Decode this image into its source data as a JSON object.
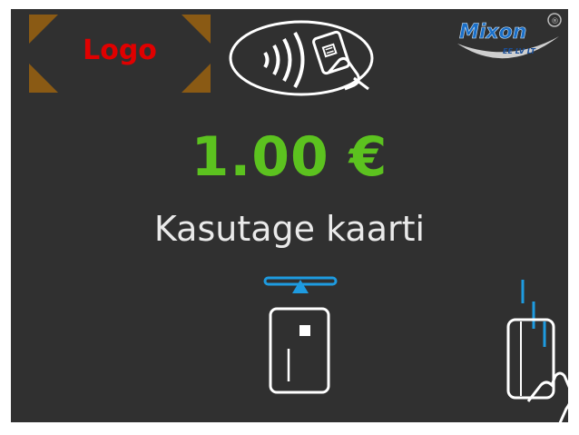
{
  "header": {
    "logo_text": "Logo",
    "brand_name": "Mixon",
    "brand_tagline": "EE LV LT",
    "brand_mark": "®"
  },
  "payment": {
    "amount": "1.00 €",
    "instruction": "Kasutage kaarti"
  },
  "icons": {
    "contactless": "contactless-tap-icon",
    "chip_insert": "chip-card-insert-icon",
    "swipe": "card-swipe-icon"
  },
  "colors": {
    "screen_bg": "#303030",
    "amount": "#5cc21f",
    "logo_text": "#e00000",
    "accent_blue": "#1e9be0",
    "logo_corners": "#8a5a14"
  }
}
